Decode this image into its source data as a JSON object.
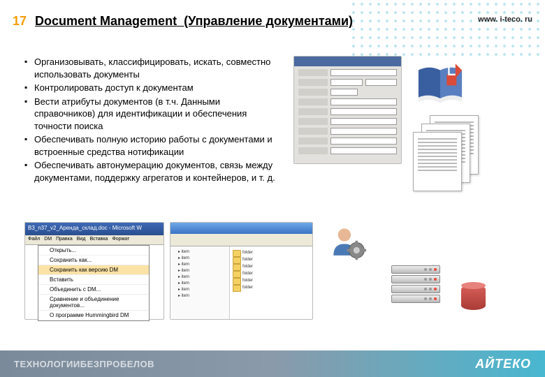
{
  "slideNumber": "17",
  "titleEn": "Document Management",
  "titleRu": "(Управление документами)",
  "site": "www. i-teco. ru",
  "bullets": [
    "Организовывать, классифицировать, искать, совместно использовать документы",
    "Контролировать доступ к документам",
    "Вести атрибуты документов (в т.ч. Данными справочников) для идентификации и обеспечения точности поиска",
    "Обеспечивать полную историю работы с документами и встроенные средства нотификации",
    "Обеспечивать автонумерацию документов, связь между документами, поддержку агрегатов и контейнеров, и т. д."
  ],
  "word": {
    "titlebar": "B3_n37_v2_Аренда_склад.doc - Microsoft W",
    "menus": [
      "Файл",
      "DM",
      "Правка",
      "Вид",
      "Вставка",
      "Формат"
    ],
    "dropdown": [
      "Открыть...",
      "Сохранить как...",
      "Сохранить как версию DM",
      "Вставить",
      "Объединить с DM...",
      "Сравнение и объединение документов...",
      "О программе Hummingbird DM"
    ]
  },
  "footerLeft": "ТЕХНОЛОГИИБЕЗПРОБЕЛОВ",
  "footerRight": "АЙТЕКО"
}
